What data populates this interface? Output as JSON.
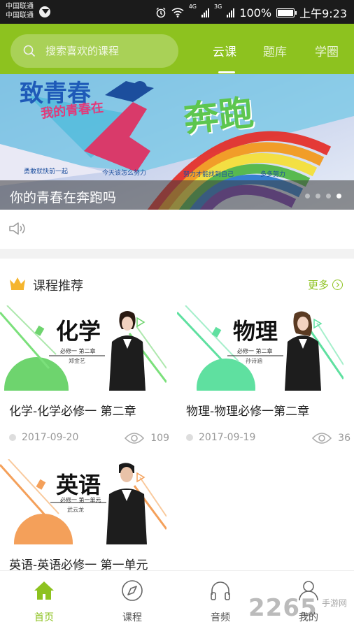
{
  "status_bar": {
    "carrier_1": "中国联通",
    "carrier_2": "中国联通",
    "net_1": "4G",
    "net_2": "3G",
    "battery": "100%",
    "time": "上午9:23"
  },
  "header": {
    "search_placeholder": "搜索喜欢的课程",
    "tabs": [
      {
        "label": "云课",
        "active": true
      },
      {
        "label": "题库",
        "active": false
      },
      {
        "label": "学圈",
        "active": false
      }
    ],
    "accent_color": "#8dc21f"
  },
  "banner": {
    "title_1": "致青春",
    "title_2": "我的青春在",
    "title_3": "奔跑",
    "slogan_1": "勇敢就快前一起",
    "slogan_2": "今天该怎么努力",
    "slogan_3": "努力才能找到自己",
    "slogan_4": "多多努力",
    "caption": "你的青春在奔跑吗",
    "slide_count": 4,
    "active_slide": 4
  },
  "notice": {
    "icon": "speaker-icon"
  },
  "section": {
    "title": "课程推荐",
    "more_label": "更多"
  },
  "courses": [
    {
      "subject": "化学",
      "subtitle": "必修一 第二章",
      "teacher": "郑金艺",
      "title": "化学-化学必修一 第二章",
      "date": "2017-09-20",
      "views": "109",
      "accent": "#6ed46e"
    },
    {
      "subject": "物理",
      "subtitle": "必修一 第二章",
      "teacher": "孙诗涵",
      "title": "物理-物理必修一第二章",
      "date": "2017-09-19",
      "views": "36",
      "accent": "#5fe0a0"
    },
    {
      "subject": "英语",
      "subtitle": "必修一 第一单元",
      "teacher": "武云龙",
      "title": "英语-英语必修一 第一单元",
      "date": "",
      "views": "",
      "accent": "#f4a05a"
    }
  ],
  "bottom_nav": [
    {
      "label": "首页",
      "icon": "home-icon",
      "active": true
    },
    {
      "label": "课程",
      "icon": "compass-icon",
      "active": false
    },
    {
      "label": "音频",
      "icon": "headphones-icon",
      "active": false
    },
    {
      "label": "我的",
      "icon": "person-icon",
      "active": false
    }
  ],
  "watermark": {
    "brand": "2265",
    "sub": "手游网",
    "domain_hint": "com"
  }
}
